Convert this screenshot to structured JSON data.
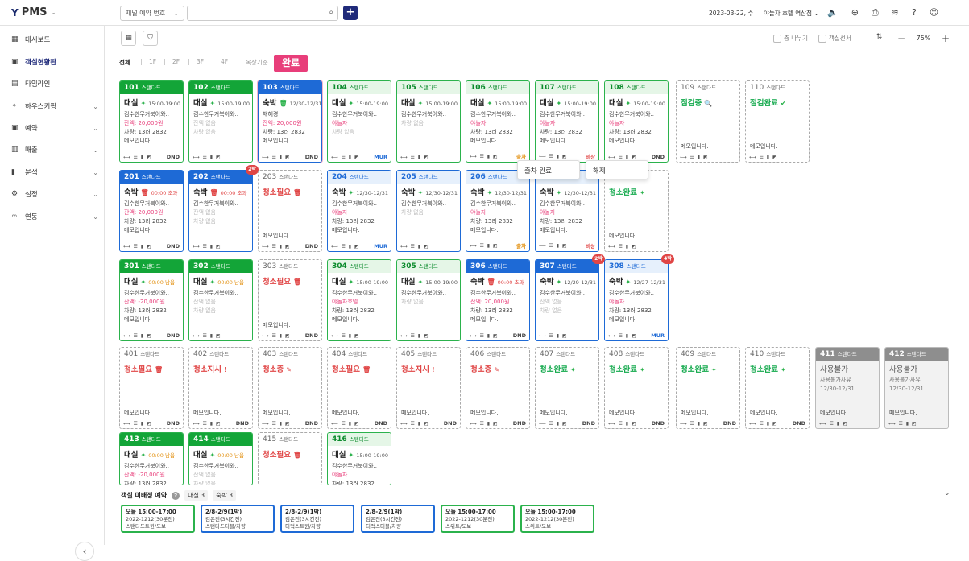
{
  "app": {
    "title": "PMS"
  },
  "header": {
    "select_label": "채널 예약 번호",
    "search_placeholder": "",
    "date": "2023-03-22, 수",
    "hotel": "야놀자 호텔 역삼점"
  },
  "sidebar": {
    "items": [
      {
        "label": "대시보드",
        "icon": "grid-icon",
        "chev": false
      },
      {
        "label": "객실현황판",
        "icon": "calendar-icon",
        "chev": false,
        "active": true
      },
      {
        "label": "타임라인",
        "icon": "timeline-icon",
        "chev": false
      },
      {
        "label": "하우스키핑",
        "icon": "sparkle-icon",
        "chev": true
      },
      {
        "label": "예약",
        "icon": "calendar-icon",
        "chev": true
      },
      {
        "label": "매출",
        "icon": "receipt-icon",
        "chev": true
      },
      {
        "label": "분석",
        "icon": "chart-icon",
        "chev": true
      },
      {
        "label": "설정",
        "icon": "gear-icon",
        "chev": true
      },
      {
        "label": "연동",
        "icon": "link-icon",
        "chev": true
      }
    ]
  },
  "toolbar": {
    "chk1": "층 나누기",
    "chk2": "객실선서",
    "zoom": "75%"
  },
  "floors": [
    "전체",
    "1F",
    "2F",
    "3F",
    "4F",
    "옥상기준"
  ],
  "tooltip": "완료",
  "popup": {
    "a": "출차 완료",
    "b": "해제"
  },
  "rooms": [
    {
      "no": "101",
      "type": "스탠다드",
      "st": "g",
      "status": "대실",
      "ic": "✦",
      "time": "15:00-19:00",
      "guest": "김수한무거북이와..",
      "balance": "잔액: 20,000원",
      "car": "차량: 13러 2832",
      "memo": "메모입니다.",
      "ft": "DND",
      "ftc": "dnd"
    },
    {
      "no": "102",
      "type": "스탠다드",
      "st": "g",
      "status": "대실",
      "ic": "✦",
      "time": "15:00-19:00",
      "guest": "김수한무거북이와..",
      "bal_l": "잔액 없음",
      "car_l": "차량 없음",
      "ft": "",
      "ftc": ""
    },
    {
      "no": "103",
      "type": "스탠다드",
      "st": "b",
      "status": "숙박",
      "ic": "🗑",
      "time": "12/30-12/31",
      "guest": "채혜경",
      "balance": "잔액: 20,000원",
      "car": "차량: 13러 2832",
      "memo": "메모입니다.",
      "ft": "DND",
      "ftc": "dnd"
    },
    {
      "no": "104",
      "type": "스탠다드",
      "st": "lg",
      "status": "대실",
      "ic": "✦",
      "time": "15:00-19:00",
      "guest": "김수한무거북이와..",
      "tag": "야놀자",
      "car_l": "차량 없음",
      "ft": "MUR",
      "ftc": "mur"
    },
    {
      "no": "105",
      "type": "스탠다드",
      "st": "lg",
      "status": "대실",
      "ic": "✦",
      "time": "15:00-19:00",
      "guest": "김수한무거북이와..",
      "car_l": "차량 없음",
      "ft": "",
      "ftc": ""
    },
    {
      "no": "106",
      "type": "스탠다드",
      "st": "lg",
      "status": "대실",
      "ic": "✦",
      "time": "15:00-19:00",
      "guest": "김수한무거북이와..",
      "tag": "야놀자",
      "car": "차량: 13러 2832",
      "memo": "메모입니다.",
      "ft": "출차",
      "ftc": "out"
    },
    {
      "no": "107",
      "type": "스탠다드",
      "st": "lg",
      "status": "대실",
      "ic": "✦",
      "time": "15:00-19:00",
      "guest": "김수한무거북이와..",
      "tag": "야놀자",
      "car": "차량: 13러 2832",
      "memo": "메모입니다.",
      "ft": "비상",
      "ftc": "emg"
    },
    {
      "no": "108",
      "type": "스탠다드",
      "st": "lg",
      "status": "대실",
      "ic": "✦",
      "time": "15:00-19:00",
      "guest": "김수한무거북이와..",
      "tag": "야놀자",
      "car": "차량: 13러 2832",
      "memo": "메모입니다.",
      "ft": "DND",
      "ftc": "dnd"
    },
    {
      "no": "109",
      "type": "스탠다드",
      "st": "e",
      "status": "점검중",
      "sc": "green",
      "ic": "🔍",
      "memo": "메모입니다."
    },
    {
      "no": "110",
      "type": "스탠다드",
      "st": "e",
      "status": "점검완료",
      "sc": "green",
      "ic": "✔",
      "memo": "메모입니다."
    },
    {
      "no": "201",
      "type": "스탠다드",
      "st": "b",
      "status": "숙박",
      "ic": "🗑",
      "ic_c": "r",
      "time": "00:00 초과",
      "tc": "red",
      "guest": "김수한무거북이와..",
      "balance": "잔액: 20,000원",
      "car": "차량: 13러 2832",
      "memo": "메모입니다.",
      "ft": "DND",
      "ftc": "dnd"
    },
    {
      "no": "202",
      "type": "스탠다드",
      "st": "b",
      "status": "숙박",
      "ic": "🗑",
      "ic_c": "r",
      "time": "00:00 초과",
      "tc": "red",
      "guest": "김수한무거북이와..",
      "bal_l": "잔액 없음",
      "car_l": "차량 없음",
      "ft": "",
      "ftc": "",
      "badge": "2박"
    },
    {
      "no": "203",
      "type": "스탠다드",
      "st": "e",
      "status": "청소필요",
      "sc": "red",
      "ic": "🗑",
      "ic_c": "r",
      "memo": "메모입니다.",
      "ft": "DND",
      "ftc": "dnd"
    },
    {
      "no": "204",
      "type": "스탠다드",
      "st": "lb",
      "status": "숙박",
      "ic": "✦",
      "time": "12/30-12/31",
      "guest": "김수한무거북이와..",
      "tag": "야놀자",
      "car": "차량: 13러 2832",
      "memo": "메모입니다.",
      "ft": "MUR",
      "ftc": "mur"
    },
    {
      "no": "205",
      "type": "스탠다드",
      "st": "lb",
      "status": "숙박",
      "ic": "✦",
      "time": "12/30-12/31",
      "guest": "김수한무거북이와..",
      "car_l": "차량 없음",
      "ft": "",
      "ftc": ""
    },
    {
      "no": "206",
      "type": "스탠다드",
      "st": "lb",
      "status": "숙박",
      "ic": "✦",
      "time": "12/30-12/31",
      "guest": "김수한무거북이와..",
      "tag": "야놀자",
      "car": "차량: 13러 2832",
      "memo": "메모입니다.",
      "ft": "출차",
      "ftc": "out"
    },
    {
      "no": "207",
      "type": "스탠다드",
      "st": "lb",
      "status": "숙박",
      "ic": "✦",
      "time": "12/30-12/31",
      "guest": "김수한무거북이와..",
      "tag": "야놀자",
      "car": "차량: 13러 2832",
      "memo": "메모입니다.",
      "ft": "비상",
      "ftc": "emg"
    },
    {
      "no": "208",
      "type": "스탠다드",
      "st": "e",
      "status": "청소완료",
      "sc": "green",
      "ic": "✦",
      "memo": "메모입니다."
    },
    {
      "no": "301",
      "type": "스탠다드",
      "st": "g",
      "status": "대실",
      "ic": "✦",
      "time": "00:00 남음",
      "tc": "or",
      "guest": "김수한무거북이와..",
      "balance": "잔액: -20,000원",
      "car": "차량: 13러 2832",
      "memo": "메모입니다.",
      "ft": "DND",
      "ftc": "dnd"
    },
    {
      "no": "302",
      "type": "스탠다드",
      "st": "g",
      "status": "대실",
      "ic": "✦",
      "time": "00:00 남음",
      "tc": "or",
      "guest": "김수한무거북이와..",
      "bal_l": "잔액 없음",
      "car_l": "차량 없음",
      "ft": "",
      "ftc": ""
    },
    {
      "no": "303",
      "type": "스탠다드",
      "st": "e",
      "status": "청소필요",
      "sc": "red",
      "ic": "🗑",
      "ic_c": "r",
      "memo": "메모입니다.",
      "ft": "DND",
      "ftc": "dnd"
    },
    {
      "no": "304",
      "type": "스탠다드",
      "st": "lg",
      "status": "대실",
      "ic": "✦",
      "time": "15:00-19:00",
      "guest": "김수한무거북이와..",
      "tag": "야놀자호텔",
      "car": "차량: 13러 2832",
      "memo": "메모입니다.",
      "ft": "",
      "ftc": ""
    },
    {
      "no": "305",
      "type": "스탠다드",
      "st": "lg",
      "status": "대실",
      "ic": "✦",
      "time": "15:00-19:00",
      "guest": "김수한무거북이와..",
      "car_l": "차량 없음",
      "ft": "",
      "ftc": ""
    },
    {
      "no": "306",
      "type": "스탠다드",
      "st": "b",
      "status": "숙박",
      "ic": "🗑",
      "ic_c": "r",
      "time": "00:00 초과",
      "tc": "red",
      "guest": "김수한무거북이와..",
      "balance": "잔액: 20,000원",
      "car": "차량: 13러 2832",
      "memo": "메모입니다.",
      "ft": "DND",
      "ftc": "dnd"
    },
    {
      "no": "307",
      "type": "스탠다드",
      "st": "b",
      "status": "숙박",
      "ic": "✦",
      "time": "12/29-12/31",
      "guest": "김수한무거북이와..",
      "bal_l": "잔액 없음",
      "car_l": "차량 없음",
      "ft": "",
      "ftc": "",
      "badge": "2박"
    },
    {
      "no": "308",
      "type": "스탠다드",
      "st": "lb",
      "status": "숙박",
      "ic": "✦",
      "time": "12/27-12/31",
      "guest": "김수한무거북이와..",
      "tag": "야놀자",
      "car": "차량: 13러 2832",
      "memo": "메모입니다.",
      "ft": "MUR",
      "ftc": "mur",
      "badge": "4박"
    },
    {
      "no": "401",
      "type": "스탠다드",
      "st": "e",
      "status": "청소필요",
      "sc": "red",
      "ic": "🗑",
      "ic_c": "r",
      "memo": "메모입니다.",
      "ft": "DND",
      "ftc": "dnd"
    },
    {
      "no": "402",
      "type": "스탠다드",
      "st": "e",
      "status": "청소지시",
      "sc": "red",
      "ic": "!",
      "ic_c": "r",
      "memo": "메모입니다.",
      "ft": "DND",
      "ftc": "dnd"
    },
    {
      "no": "403",
      "type": "스탠다드",
      "st": "e",
      "status": "청소중",
      "sc": "red",
      "ic": "✎",
      "ic_c": "r",
      "memo": "메모입니다.",
      "ft": "DND",
      "ftc": "dnd"
    },
    {
      "no": "404",
      "type": "스탠다드",
      "st": "e",
      "status": "청소필요",
      "sc": "red",
      "ic": "🗑",
      "ic_c": "r",
      "memo": "메모입니다.",
      "ft": "DND",
      "ftc": "dnd"
    },
    {
      "no": "405",
      "type": "스탠다드",
      "st": "e",
      "status": "청소지시",
      "sc": "red",
      "ic": "!",
      "ic_c": "r",
      "memo": "메모입니다.",
      "ft": "DND",
      "ftc": "dnd"
    },
    {
      "no": "406",
      "type": "스탠다드",
      "st": "e",
      "status": "청소중",
      "sc": "red",
      "ic": "✎",
      "ic_c": "r",
      "memo": "메모입니다.",
      "ft": "DND",
      "ftc": "dnd"
    },
    {
      "no": "407",
      "type": "스탠다드",
      "st": "e",
      "status": "청소완료",
      "sc": "green",
      "ic": "✦",
      "memo": "메모입니다.",
      "ft": "DND",
      "ftc": "dnd"
    },
    {
      "no": "408",
      "type": "스탠다드",
      "st": "e",
      "status": "청소완료",
      "sc": "green",
      "ic": "✦",
      "memo": "메모입니다.",
      "ft": "DND",
      "ftc": "dnd"
    },
    {
      "no": "409",
      "type": "스탠다드",
      "st": "e",
      "status": "청소완료",
      "sc": "green",
      "ic": "✦",
      "memo": "메모입니다.",
      "ft": "DND",
      "ftc": "dnd"
    },
    {
      "no": "410",
      "type": "스탠다드",
      "st": "e",
      "status": "청소완료",
      "sc": "green",
      "ic": "✦",
      "memo": "메모입니다.",
      "ft": "DND",
      "ftc": "dnd"
    },
    {
      "no": "411",
      "type": "스탠다드",
      "st": "gr",
      "status": "사용불가",
      "sc": "gray",
      "reason": "사용불가사유",
      "period": "12/30-12/31",
      "memo": "메모입니다."
    },
    {
      "no": "412",
      "type": "스탠다드",
      "st": "gr",
      "status": "사용불가",
      "sc": "gray",
      "reason": "사용불가사유",
      "period": "12/30-12/31",
      "memo": "메모입니다."
    },
    {
      "no": "413",
      "type": "스탠다드",
      "st": "g",
      "status": "대실",
      "ic": "✦",
      "time": "00:00 남음",
      "tc": "or",
      "guest": "김수한무거북이와..",
      "balance": "잔액: -20,000원",
      "car": "차량: 13러 2832"
    },
    {
      "no": "414",
      "type": "스탠다드",
      "st": "g",
      "status": "대실",
      "ic": "✦",
      "time": "00:00 남음",
      "tc": "or",
      "guest": "김수한무거북이와..",
      "bal_l": "잔액 없음",
      "car_l": "차량 없음"
    },
    {
      "no": "415",
      "type": "스탠다드",
      "st": "e",
      "status": "청소필요",
      "sc": "red",
      "ic": "🗑",
      "ic_c": "r"
    },
    {
      "no": "416",
      "type": "스탠다드",
      "st": "lg",
      "status": "대실",
      "ic": "✦",
      "time": "15:00-19:00",
      "guest": "김수한무거북이와..",
      "tag": "야놀자",
      "car": "차량: 13러 2832"
    }
  ],
  "unassigned": {
    "title": "객실 미배정 예약",
    "tag1": "대실 3",
    "tag2": "숙박 3",
    "cards": [
      {
        "c": "g",
        "l1": "오늘 15:00-17:00",
        "l2": "2022-1212(30분전)",
        "l3": "스탠다드트윈/도보"
      },
      {
        "c": "b",
        "l1": "2/8-2/9(1박)",
        "l2": "김은진(3시간전)",
        "l3": "스탠다드더블/차량"
      },
      {
        "c": "b",
        "l1": "2/8-2/9(1박)",
        "l2": "김은진(3시간전)",
        "l3": "디럭스트윈/차량"
      },
      {
        "c": "b",
        "l1": "2/8-2/9(1박)",
        "l2": "김은진(3시간전)",
        "l3": "디럭스더블/차량"
      },
      {
        "c": "g",
        "l1": "오늘 15:00-17:00",
        "l2": "2022-1212(30분전)",
        "l3": "스위트/도보"
      },
      {
        "c": "g",
        "l1": "오늘 15:00-17:00",
        "l2": "2022-1212(30분전)",
        "l3": "스위트/도보"
      }
    ]
  }
}
